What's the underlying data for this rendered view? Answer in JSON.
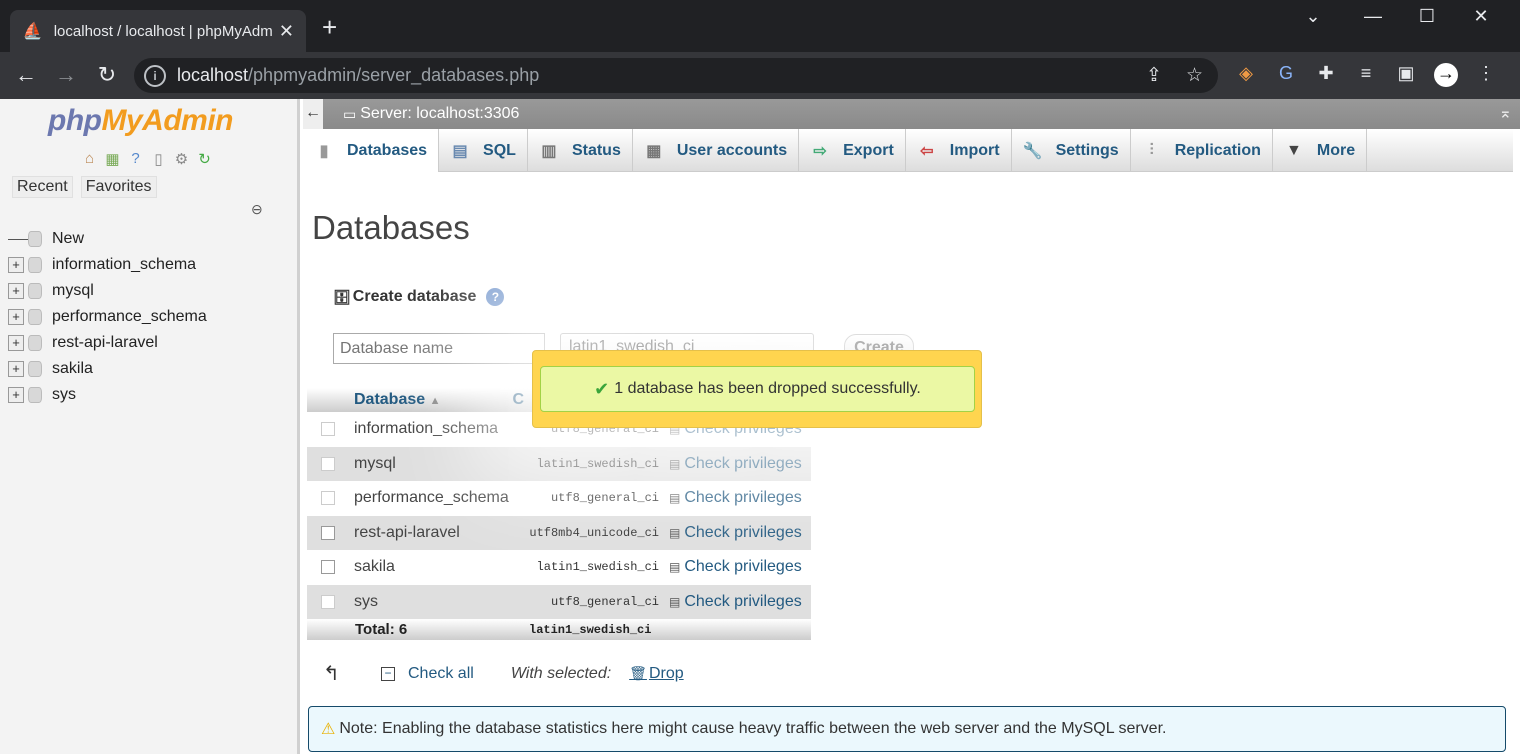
{
  "browser": {
    "tab_title": "localhost / localhost | phpMyAdm",
    "url_host": "localhost",
    "url_path": "/phpmyadmin/server_databases.php"
  },
  "sidebar": {
    "logo_php": "php",
    "logo_myadmin": "MyAdmin",
    "recent": "Recent",
    "favorites": "Favorites",
    "tree": [
      {
        "label": "New"
      },
      {
        "label": "information_schema"
      },
      {
        "label": "mysql"
      },
      {
        "label": "performance_schema"
      },
      {
        "label": "rest-api-laravel"
      },
      {
        "label": "sakila"
      },
      {
        "label": "sys"
      }
    ]
  },
  "server_bar": {
    "title": "Server: localhost:3306"
  },
  "menu": [
    {
      "label": "Databases",
      "icon": "database-icon"
    },
    {
      "label": "SQL",
      "icon": "sql-icon"
    },
    {
      "label": "Status",
      "icon": "status-icon"
    },
    {
      "label": "User accounts",
      "icon": "users-icon"
    },
    {
      "label": "Export",
      "icon": "export-icon"
    },
    {
      "label": "Import",
      "icon": "import-icon"
    },
    {
      "label": "Settings",
      "icon": "wrench-icon"
    },
    {
      "label": "Replication",
      "icon": "replication-icon"
    },
    {
      "label": "More",
      "icon": "caret-down-icon"
    }
  ],
  "page": {
    "heading": "Databases",
    "create_label": "Create database",
    "dbname_placeholder": "Database name",
    "collation_selected": "latin1_swedish_ci",
    "create_button": "Create"
  },
  "table": {
    "col_database": "Database",
    "col_collation": "C",
    "rows": [
      {
        "name": "information_schema",
        "collation": "utf8_general_ci",
        "action": "Check privileges"
      },
      {
        "name": "mysql",
        "collation": "latin1_swedish_ci",
        "action": "Check privileges"
      },
      {
        "name": "performance_schema",
        "collation": "utf8_general_ci",
        "action": "Check privileges"
      },
      {
        "name": "rest-api-laravel",
        "collation": "utf8mb4_unicode_ci",
        "action": "Check privileges"
      },
      {
        "name": "sakila",
        "collation": "latin1_swedish_ci",
        "action": "Check privileges"
      },
      {
        "name": "sys",
        "collation": "utf8_general_ci",
        "action": "Check privileges"
      }
    ],
    "total_label": "Total: 6",
    "total_collation": "latin1_swedish_ci"
  },
  "bulk": {
    "check_all": "Check all",
    "with_selected": "With selected:",
    "drop": "Drop"
  },
  "note": "Note: Enabling the database statistics here might cause heavy traffic between the web server and the MySQL server.",
  "toast": "1 database has been dropped successfully."
}
